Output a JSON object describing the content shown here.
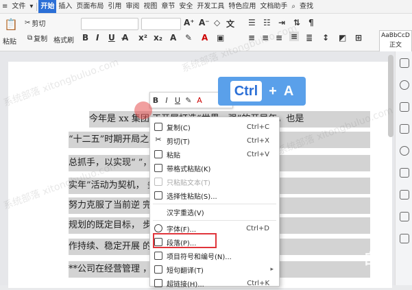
{
  "menubar": {
    "file": "文件",
    "tabs": [
      "开始",
      "插入",
      "页面布局",
      "引用",
      "审阅",
      "视图",
      "章节",
      "安全",
      "开发工具",
      "特色应用",
      "文档助手"
    ],
    "search": "查找"
  },
  "ribbon": {
    "paste": "粘贴",
    "cut": "剪切",
    "copy": "复制",
    "format_painter": "格式刷",
    "style_preview": "AaBbCcD",
    "style_name": "正文"
  },
  "document": {
    "lines": [
      "今年是 xx 集团 正开展打造“世界一强”的开局年，也是",
      "“十二五”时期开局之年，集团公司提出“十个转变”为",
      "总抓手，以实现“    ”，在“精细化管理·落",
      "实年”活动为契机，   务实，扎实工作，",
      "努力克服了当前逆     完成了“十二五”",
      "规划的既定目标，      步态势，各项工",
      "作持续、稳定开展     的看，20xx 年，",
      "**公司在经营管理        ，内控管理，"
    ]
  },
  "minibar": {
    "bold": "B",
    "italic": "I",
    "underline": "U",
    "font_color": "A"
  },
  "shortcut": {
    "key": "Ctrl",
    "plus": "+",
    "letter": "A"
  },
  "context_menu": {
    "items": [
      {
        "label": "复制(C)",
        "shortcut": "Ctrl+C",
        "icon": "copy-icon",
        "disabled": false
      },
      {
        "label": "剪切(T)",
        "shortcut": "Ctrl+X",
        "icon": "cut-icon",
        "disabled": false
      },
      {
        "label": "粘贴",
        "shortcut": "Ctrl+V",
        "icon": "paste-icon",
        "disabled": false
      },
      {
        "label": "带格式粘贴(K)",
        "shortcut": "",
        "icon": "paste-format-icon",
        "disabled": false
      },
      {
        "label": "只粘贴文本(T)",
        "shortcut": "",
        "icon": "paste-text-icon",
        "disabled": true
      },
      {
        "label": "选择性粘贴(S)...",
        "shortcut": "",
        "icon": "paste-special-icon",
        "disabled": false
      },
      {
        "label": "汉字重选(V)",
        "shortcut": "",
        "icon": "",
        "disabled": false
      },
      {
        "label": "字体(F)...",
        "shortcut": "Ctrl+D",
        "icon": "font-icon",
        "disabled": false
      },
      {
        "label": "段落(P)...",
        "shortcut": "",
        "icon": "paragraph-icon",
        "disabled": false
      },
      {
        "label": "项目符号和编号(N)...",
        "shortcut": "",
        "icon": "list-icon",
        "disabled": false
      },
      {
        "label": "短句翻译(T)",
        "shortcut": "",
        "icon": "translate-icon",
        "disabled": false
      },
      {
        "label": "超链接(H)...",
        "shortcut": "Ctrl+K",
        "icon": "link-icon",
        "disabled": false
      }
    ]
  },
  "watermark": "系统部落 xitongbuluo.com",
  "brand": "自由"
}
